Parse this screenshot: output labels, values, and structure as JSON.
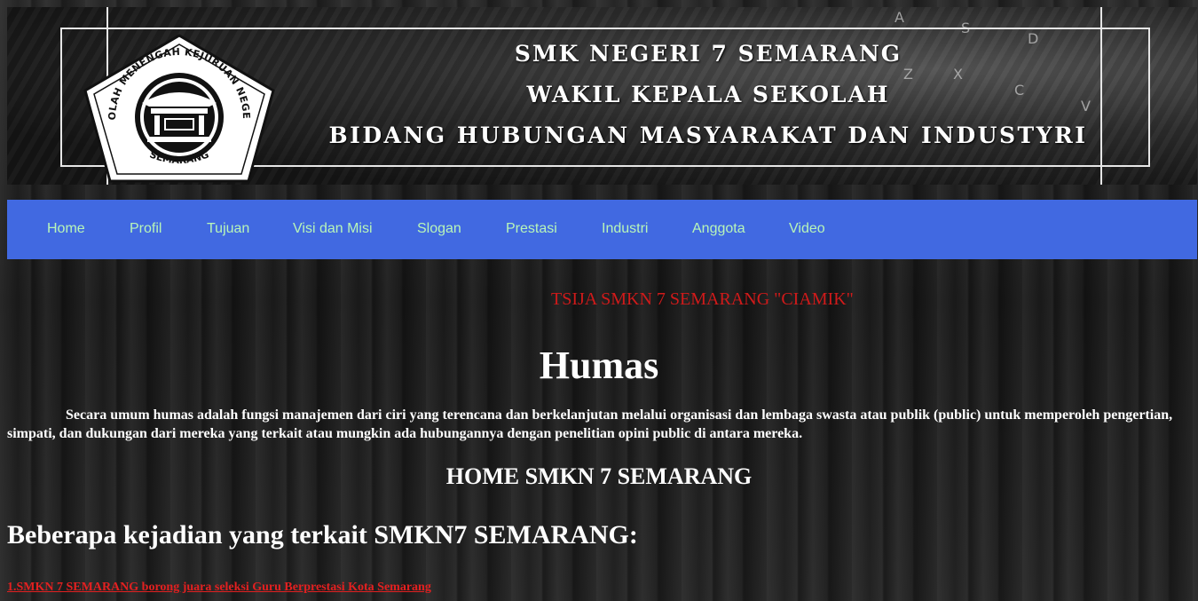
{
  "header": {
    "title_line1": "SMK NEGERI 7 SEMARANG",
    "title_line2": "WAKIL KEPALA SEKOLAH",
    "title_line3": "BIDANG HUBUNGAN MASYARAKAT DAN INDUSTYRI",
    "logo_text": "SEKOLAH MENENGAH KEJURUAN NEGERI 7",
    "logo_city": "SEMARANG",
    "keyboard_glyphs": [
      "A",
      "S",
      "D",
      "Z",
      "X",
      "C",
      "V"
    ]
  },
  "nav": {
    "items": [
      "Home",
      "Profil",
      "Tujuan",
      "Visi dan Misi",
      "Slogan",
      "Prestasi",
      "Industri",
      "Anggota",
      "Video"
    ]
  },
  "main": {
    "marquee": "TSIJA SMKN 7 SEMARANG \"CIAMIK\"",
    "title": "Humas",
    "intro": "Secara umum humas adalah fungsi manajemen dari ciri yang terencana dan berkelanjutan melalui organisasi dan lembaga swasta atau publik (public) untuk memperoleh pengertian, simpati, dan dukungan dari mereka yang terkait atau mungkin ada hubungannya dengan penelitian opini public di antara mereka.",
    "home_heading": "HOME SMKN 7 SEMARANG",
    "events_heading": "Beberapa kejadian yang terkait SMKN7 SEMARANG:",
    "event_links": [
      "1.SMKN 7 SEMARANG borong juara seleksi Guru Berprestasi Kota Semarang"
    ]
  },
  "colors": {
    "nav_bg": "#4169e1",
    "nav_text": "#b8f5b8",
    "marquee": "#d01a1a",
    "link": "#e32020"
  }
}
